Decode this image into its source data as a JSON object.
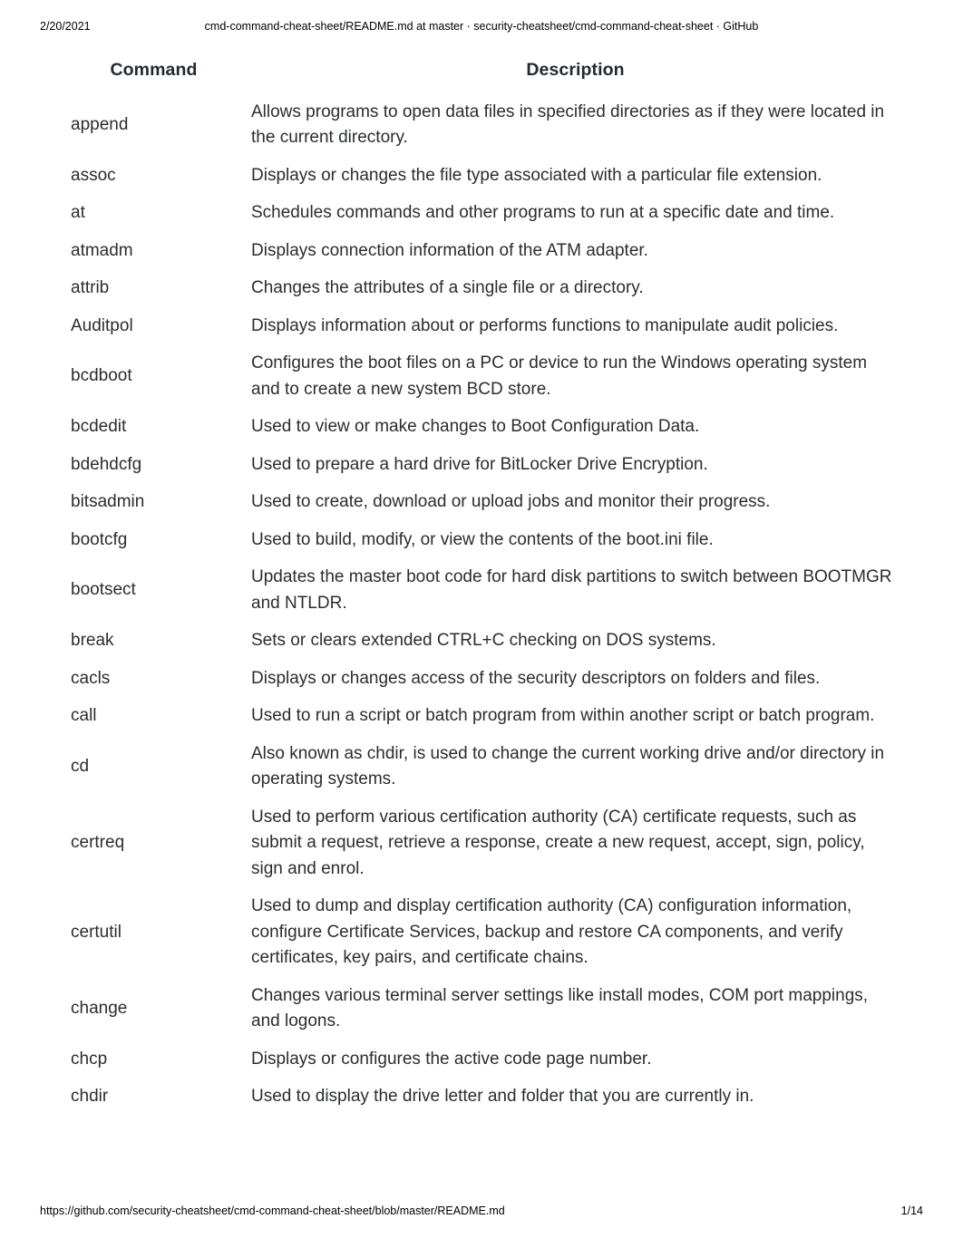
{
  "print_header": {
    "date": "2/20/2021",
    "title": "cmd-command-cheat-sheet/README.md at master · security-cheatsheet/cmd-command-cheat-sheet · GitHub"
  },
  "print_footer": {
    "url": "https://github.com/security-cheatsheet/cmd-command-cheat-sheet/blob/master/README.md",
    "page": "1/14"
  },
  "table": {
    "headers": {
      "command": "Command",
      "description": "Description"
    },
    "rows": [
      {
        "command": "append",
        "description": "Allows programs to open data files in specified directories as if they were located in the current directory."
      },
      {
        "command": "assoc",
        "description": "Displays or changes the file type associated with a particular file extension."
      },
      {
        "command": "at",
        "description": "Schedules commands and other programs to run at a specific date and time."
      },
      {
        "command": "atmadm",
        "description": "Displays connection information of the ATM adapter."
      },
      {
        "command": "attrib",
        "description": "Changes the attributes of a single file or a directory."
      },
      {
        "command": "Auditpol",
        "description": "Displays information about or performs functions to manipulate audit policies."
      },
      {
        "command": "bcdboot",
        "description": "Configures the boot files on a PC or device to run the Windows operating system and to create a new system BCD store."
      },
      {
        "command": "bcdedit",
        "description": "Used to view or make changes to Boot Configuration Data."
      },
      {
        "command": "bdehdcfg",
        "description": "Used to prepare a hard drive for BitLocker Drive Encryption."
      },
      {
        "command": "bitsadmin",
        "description": "Used to create, download or upload jobs and monitor their progress."
      },
      {
        "command": "bootcfg",
        "description": "Used to build, modify, or view the contents of the boot.ini file."
      },
      {
        "command": "bootsect",
        "description": "Updates the master boot code for hard disk partitions to switch between BOOTMGR and NTLDR."
      },
      {
        "command": "break",
        "description": "Sets or clears extended CTRL+C checking on DOS systems."
      },
      {
        "command": "cacls",
        "description": "Displays or changes access of the security descriptors on folders and files."
      },
      {
        "command": "call",
        "description": "Used to run a script or batch program from within another script or batch program."
      },
      {
        "command": "cd",
        "description": "Also known as chdir, is used to change the current working drive and/or directory in operating systems."
      },
      {
        "command": "certreq",
        "description": "Used to perform various certification authority (CA) certificate requests, such as submit a request, retrieve a response, create a new request, accept, sign, policy, sign and enrol."
      },
      {
        "command": "certutil",
        "description": "Used to dump and display certification authority (CA) configuration information, configure Certificate Services, backup and restore CA components, and verify certificates, key pairs, and certificate chains."
      },
      {
        "command": "change",
        "description": "Changes various terminal server settings like install modes, COM port mappings, and logons."
      },
      {
        "command": "chcp",
        "description": "Displays or configures the active code page number."
      },
      {
        "command": "chdir",
        "description": "Used to display the drive letter and folder that you are currently in."
      }
    ]
  }
}
